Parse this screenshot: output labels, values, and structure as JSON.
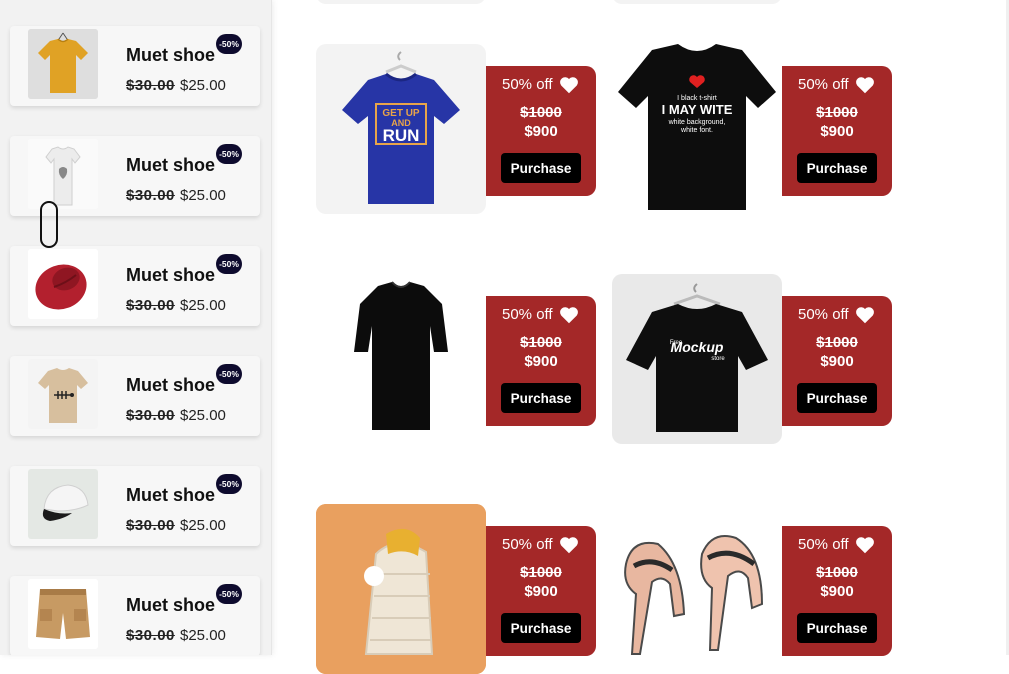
{
  "sidebar": {
    "items": [
      {
        "name": "Muet shoe",
        "old_price": "$30.00",
        "new_price": "$25.00",
        "badge": "-50%",
        "image": "yellow-tshirt"
      },
      {
        "name": "Muet shoe",
        "old_price": "$30.00",
        "new_price": "$25.00",
        "badge": "-50%",
        "image": "white-tshirt"
      },
      {
        "name": "Muet shoe",
        "old_price": "$30.00",
        "new_price": "$25.00",
        "badge": "-50%",
        "image": "red-hat"
      },
      {
        "name": "Muet shoe",
        "old_price": "$30.00",
        "new_price": "$25.00",
        "badge": "-50%",
        "image": "beige-tshirt"
      },
      {
        "name": "Muet shoe",
        "old_price": "$30.00",
        "new_price": "$25.00",
        "badge": "-50%",
        "image": "white-cap"
      },
      {
        "name": "Muet shoe",
        "old_price": "$30.00",
        "new_price": "$25.00",
        "badge": "-50%",
        "image": "cargo-shorts"
      }
    ]
  },
  "products": [
    {
      "discount": "50% off",
      "old_price": "$1000",
      "new_price": "$900",
      "button": "Purchase",
      "image": "blue-run-tshirt",
      "image_text": [
        "GET UP",
        "AND",
        "RUN"
      ]
    },
    {
      "discount": "50% off",
      "old_price": "$1000",
      "new_price": "$900",
      "button": "Purchase",
      "image": "black-i-may-wite-tshirt",
      "image_text": [
        "I  black t-shirt",
        "I MAY WITE",
        "white background,",
        "white font."
      ]
    },
    {
      "discount": "50% off",
      "old_price": "$1000",
      "new_price": "$900",
      "button": "Purchase",
      "image": "black-long-tshirt"
    },
    {
      "discount": "50% off",
      "old_price": "$1000",
      "new_price": "$900",
      "button": "Purchase",
      "image": "black-mockup-tshirt",
      "image_text": [
        "Free",
        "Mockup",
        "store"
      ]
    },
    {
      "discount": "50% off",
      "old_price": "$1000",
      "new_price": "$900",
      "button": "Purchase",
      "image": "winter-jacket"
    },
    {
      "discount": "50% off",
      "old_price": "$1000",
      "new_price": "$900",
      "button": "Purchase",
      "image": "nude-high-heels"
    }
  ],
  "colors": {
    "panel": "#a42828",
    "badge": "#0e0b2e",
    "button": "#000000"
  },
  "icons": {
    "favorite": "heart-icon"
  }
}
